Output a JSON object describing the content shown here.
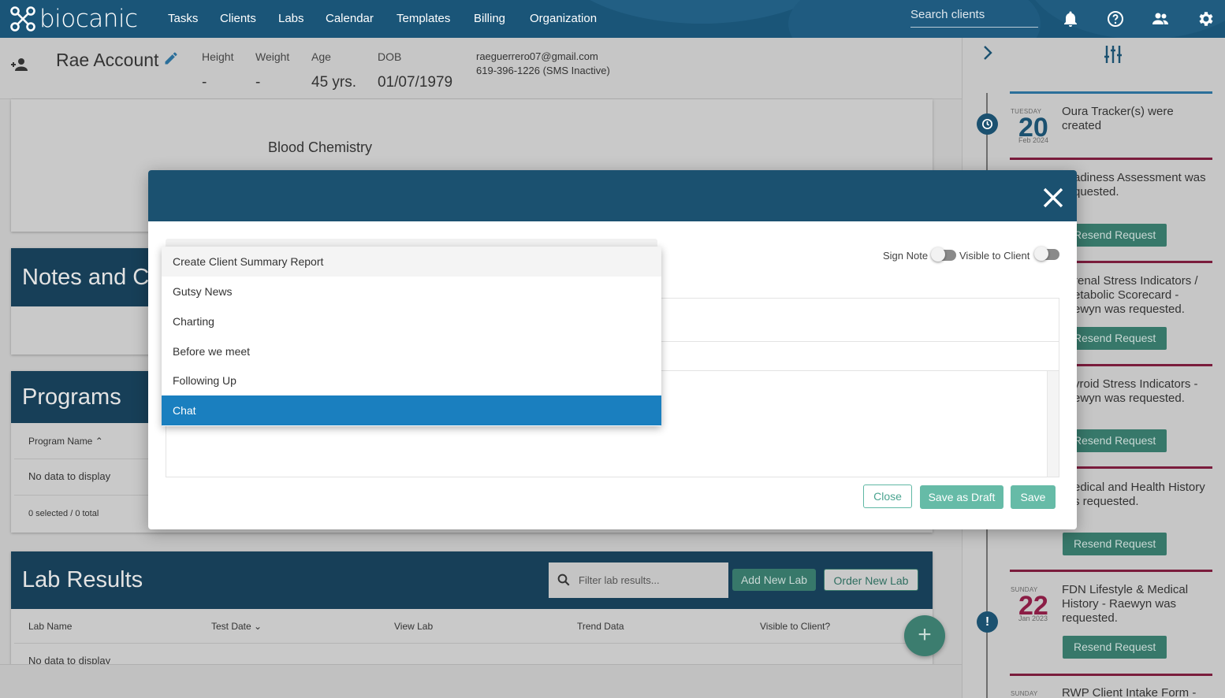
{
  "brand": {
    "name": "biocanic"
  },
  "nav": {
    "items": [
      "Tasks",
      "Clients",
      "Labs",
      "Calendar",
      "Templates",
      "Billing",
      "Organization"
    ],
    "search_placeholder": "Search clients"
  },
  "profile": {
    "name": "Rae Account",
    "height_label": "Height",
    "height_value": "-",
    "weight_label": "Weight",
    "weight_value": "-",
    "age_label": "Age",
    "age_value": "45 yrs.",
    "dob_label": "DOB",
    "dob_value": "01/07/1979",
    "email": "raeguerrero07@gmail.com",
    "phone": "619-396-1226 (SMS Inactive)"
  },
  "blood_chemistry": {
    "title": "Blood Chemistry"
  },
  "notes": {
    "title": "Notes and Co"
  },
  "programs": {
    "title": "Programs",
    "col_name": "Program Name ⌃",
    "empty": "No data to display",
    "footer": "0 selected / 0 total"
  },
  "lab_results": {
    "title": "Lab Results",
    "filter_placeholder": "Filter lab results...",
    "add_label": "Add New Lab",
    "order_label": "Order New Lab",
    "columns": [
      "Lab Name",
      "Test Date ⌄",
      "View Lab",
      "Trend Data",
      "Visible to Client?"
    ],
    "empty": "No data to display"
  },
  "modal": {
    "sign_note_label": "Sign Note",
    "visible_label": "Visible to Client",
    "close_label": "Close",
    "draft_label": "Save as Draft",
    "save_label": "Save",
    "dropdown": {
      "options": [
        "Create Client Summary Report",
        "Gutsy News",
        "Charting",
        "Before we meet",
        "Following Up",
        "Chat"
      ],
      "selected_index": 5
    }
  },
  "timeline": {
    "entries": [
      {
        "day": "TUESDAY",
        "num": "20",
        "month_year": "Feb 2024",
        "text_l1": "Oura Tracker(s) were",
        "text_l2": "created",
        "text_l3": "",
        "button": ""
      },
      {
        "day": "",
        "num": "",
        "month_year": "",
        "text_l1": "adiness Assessment was",
        "text_l2": "quested.",
        "text_l3": "",
        "button": "Resend Request"
      },
      {
        "day": "",
        "num": "",
        "month_year": "",
        "text_l1": "renal Stress Indicators /",
        "text_l2": "etabolic Scorecard -",
        "text_l3": "ewyn was requested.",
        "button": "Resend Request"
      },
      {
        "day": "",
        "num": "",
        "month_year": "",
        "text_l1": "yroid Stress Indicators -",
        "text_l2": "ewyn was requested.",
        "text_l3": "",
        "button": "Resend Request"
      },
      {
        "day": "",
        "num": "",
        "month_year": "",
        "text_l1": "edical and Health History",
        "text_l2": "s requested.",
        "text_l3": "",
        "button": "Resend Request"
      },
      {
        "day": "SUNDAY",
        "num": "22",
        "month_year": "Jan 2023",
        "text_l1": "FDN Lifestyle & Medical",
        "text_l2": "History - Raewyn was",
        "text_l3": "requested.",
        "button": "Resend Request"
      },
      {
        "day": "SUNDAY",
        "num": "",
        "month_year": "",
        "text_l1": "RWP Client Intake Form -",
        "text_l2": "",
        "text_l3": "",
        "button": ""
      }
    ]
  },
  "colors": {
    "nav": "#1a5578",
    "accent_teal": "#5fb8a4",
    "date_maroon": "#8b1d45",
    "date_blue": "#1b5170",
    "selected": "#1a7fbf"
  }
}
